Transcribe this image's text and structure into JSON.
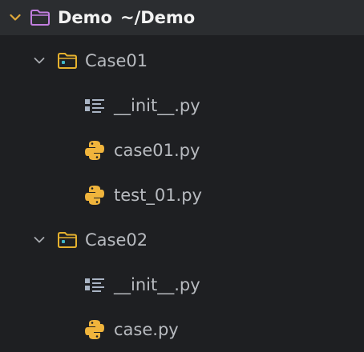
{
  "project": {
    "name": "Demo",
    "path": "~/Demo",
    "expanded": true,
    "icon": "folder-icon",
    "icon_color": "#c27fe0"
  },
  "folders": [
    {
      "label": "Case01",
      "icon": "package-folder-icon",
      "expanded": true,
      "files": [
        {
          "label": "__init__.py",
          "icon": "init-file-icon"
        },
        {
          "label": "case01.py",
          "icon": "python-icon"
        },
        {
          "label": "test_01.py",
          "icon": "python-icon"
        }
      ]
    },
    {
      "label": "Case02",
      "icon": "package-folder-icon",
      "expanded": true,
      "files": [
        {
          "label": "__init__.py",
          "icon": "init-file-icon"
        },
        {
          "label": "case.py",
          "icon": "python-icon"
        }
      ]
    }
  ],
  "colors": {
    "background": "#1e1f22",
    "root_row": "#2b2d30",
    "folder_accent": "#e5b12e",
    "python_yellow": "#f0b43c",
    "chevron_root": "#e0a83a",
    "chevron": "#a8abb0",
    "text": "#b8bbc0"
  }
}
